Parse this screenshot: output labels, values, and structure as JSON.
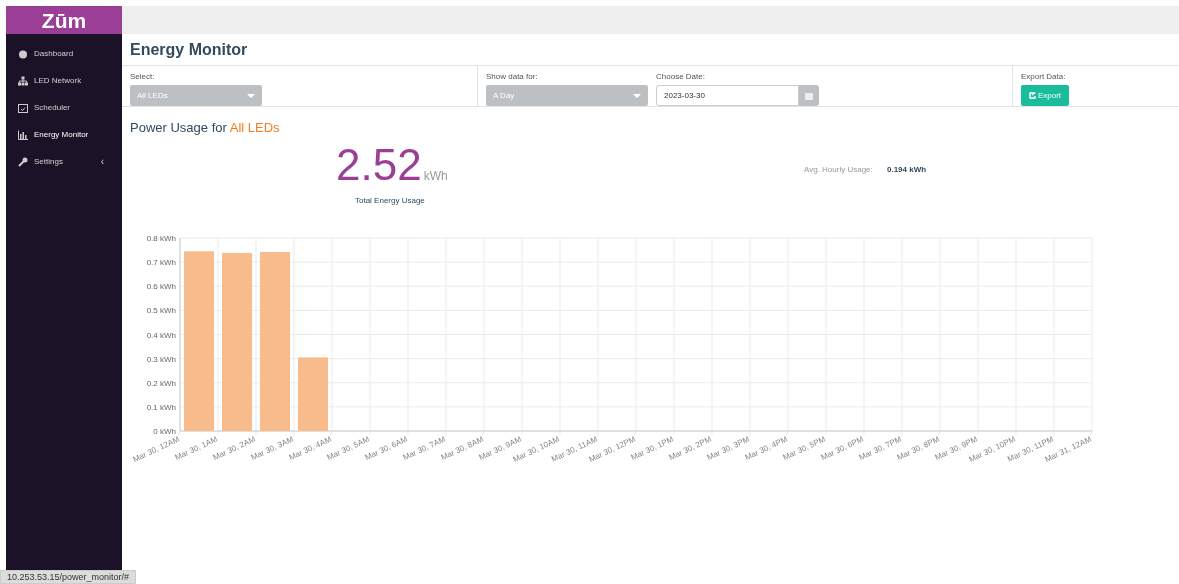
{
  "sidebar": {
    "logo": "Zūm",
    "items": [
      {
        "label": "Dashboard",
        "selected": false
      },
      {
        "label": "LED Network",
        "selected": false
      },
      {
        "label": "Scheduler",
        "selected": false
      },
      {
        "label": "Energy Monitor",
        "selected": true
      },
      {
        "label": "Settings",
        "selected": false,
        "caret": "‹"
      }
    ]
  },
  "page_title": "Energy Monitor",
  "filters": {
    "select": {
      "label": "Select:",
      "value": "All LEDs"
    },
    "show_data_for": {
      "label": "Show data for:",
      "value": "A Day"
    },
    "choose_date": {
      "label": "Choose Date:",
      "value": "2023-03-30"
    },
    "export": {
      "label": "Export Data:",
      "button": "Export"
    }
  },
  "usage": {
    "title": "Power Usage for **All LEDs**",
    "total": "2.52",
    "unit": "kWh",
    "total_label": "Total Energy Usage",
    "avg_label": "Avg. Hourly Usage:",
    "avg_value": "0.194 kWh"
  },
  "chart_data": {
    "type": "bar",
    "categories": [
      "Mar 30, 12AM",
      "Mar 30, 1AM",
      "Mar 30, 2AM",
      "Mar 30, 3AM",
      "Mar 30, 4AM",
      "Mar 30, 5AM",
      "Mar 30, 6AM",
      "Mar 30, 7AM",
      "Mar 30, 8AM",
      "Mar 30, 9AM",
      "Mar 30, 10AM",
      "Mar 30, 11AM",
      "Mar 30, 12PM",
      "Mar 30, 1PM",
      "Mar 30, 2PM",
      "Mar 30, 3PM",
      "Mar 30, 4PM",
      "Mar 30, 5PM",
      "Mar 30, 6PM",
      "Mar 30, 7PM",
      "Mar 30, 8PM",
      "Mar 30, 9PM",
      "Mar 30, 10PM",
      "Mar 30, 11PM",
      "Mar 31, 12AM"
    ],
    "grid": true,
    "series": [
      {
        "color": "#f8bb8c",
        "values": [
          0.745,
          0.738,
          0.742,
          0.305,
          null,
          null,
          null,
          null,
          null,
          null,
          null,
          null,
          null,
          null,
          null,
          null,
          null,
          null,
          null,
          null,
          null,
          null,
          null,
          null,
          null
        ]
      }
    ],
    "ylim": [
      0,
      0.8
    ],
    "yticks": [
      {
        "value": 0,
        "label": "0 kWh"
      },
      {
        "value": 0.1,
        "label": "0.1 kWh"
      },
      {
        "value": 0.2,
        "label": "0.2 kWh"
      },
      {
        "value": 0.3,
        "label": "0.3 kWh"
      },
      {
        "value": 0.4,
        "label": "0.4 kWh"
      },
      {
        "value": 0.5,
        "label": "0.5 kWh"
      },
      {
        "value": 0.6,
        "label": "0.6 kWh"
      },
      {
        "value": 0.7,
        "label": "0.7 kWh"
      },
      {
        "value": 0.8,
        "label": "0.8 kWh"
      }
    ]
  },
  "status_bar": {
    "url": "10.253.53.15/power_monitor/#"
  }
}
